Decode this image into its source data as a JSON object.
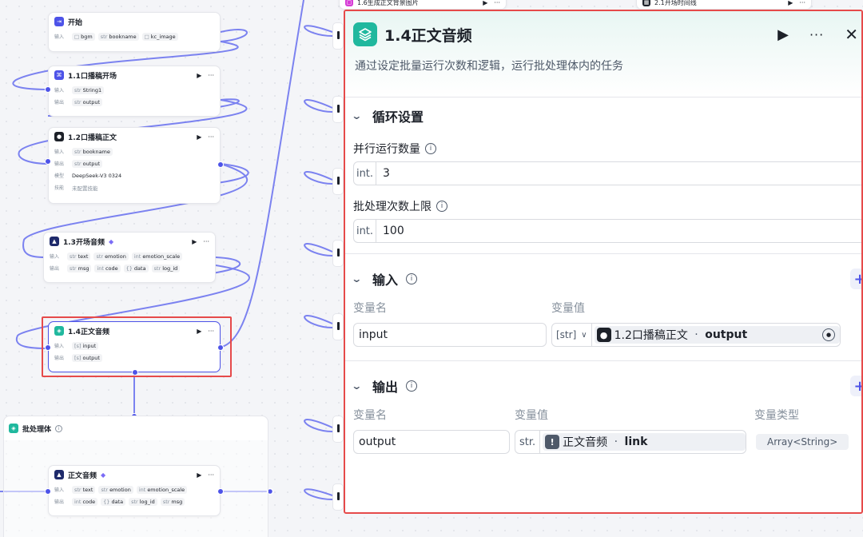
{
  "canvas": {
    "start": {
      "title": "开始",
      "input_label": "输入",
      "inputs": [
        "bgm",
        "bookname",
        "kc_image"
      ]
    },
    "node_1_1": {
      "title": "1.1口播稿开场",
      "input_label": "输入",
      "output_label": "输出",
      "input": "String1",
      "output": "output"
    },
    "node_1_2": {
      "title": "1.2口播稿正文",
      "input_label": "输入",
      "output_label": "输出",
      "model_label": "模型",
      "skill_label": "技能",
      "input": "bookname",
      "output": "output",
      "model": "DeepSeek-V3 0324",
      "skill": "未配置技能"
    },
    "node_1_3": {
      "title": "1.3开场音频",
      "input_label": "输入",
      "output_label": "输出",
      "inputs": [
        "text",
        "emotion",
        "emotion_scale"
      ],
      "outputs": [
        "msg",
        "code",
        "data",
        "log_id"
      ]
    },
    "node_1_4": {
      "title": "1.4正文音频",
      "input_label": "输入",
      "output_label": "输出",
      "input": "input",
      "output": "output"
    },
    "batch": {
      "title": "批处理体"
    },
    "inner": {
      "title": "正文音频",
      "input_label": "输入",
      "output_label": "输出",
      "inputs": [
        "text",
        "emotion",
        "emotion_scale"
      ],
      "outputs": [
        "code",
        "data",
        "log_id",
        "msg"
      ]
    },
    "node_1_6": {
      "title": "1.6生成正文背景图片"
    },
    "node_2_1": {
      "title": "2.1开场时间线"
    },
    "type_prefix": {
      "str": "str",
      "int": "int"
    }
  },
  "panel": {
    "title": "1.4正文音频",
    "description": "通过设定批量运行次数和逻辑，运行批处理体内的任务",
    "loop_section": {
      "title": "循环设置",
      "parallel_label": "并行运行数量",
      "parallel_type": "int.",
      "parallel_value": "3",
      "limit_label": "批处理次数上限",
      "limit_type": "int.",
      "limit_value": "100"
    },
    "input_section": {
      "title": "输入",
      "col_name": "变量名",
      "col_value": "变量值",
      "var_name": "input",
      "ref_type": "[str]",
      "ref_node": "1.2口播稿正文",
      "ref_sep": " · ",
      "ref_field": "output"
    },
    "output_section": {
      "title": "输出",
      "col_name": "变量名",
      "col_value": "变量值",
      "col_type": "变量类型",
      "var_name": "output",
      "ref_type": "str.",
      "ref_node": "正文音频",
      "ref_sep": " · ",
      "ref_field": "link",
      "var_type": "Array<String>"
    }
  },
  "colors": {
    "accent": "#4d53e8",
    "selected": "#e64a4a",
    "teal": "#20b89e"
  }
}
